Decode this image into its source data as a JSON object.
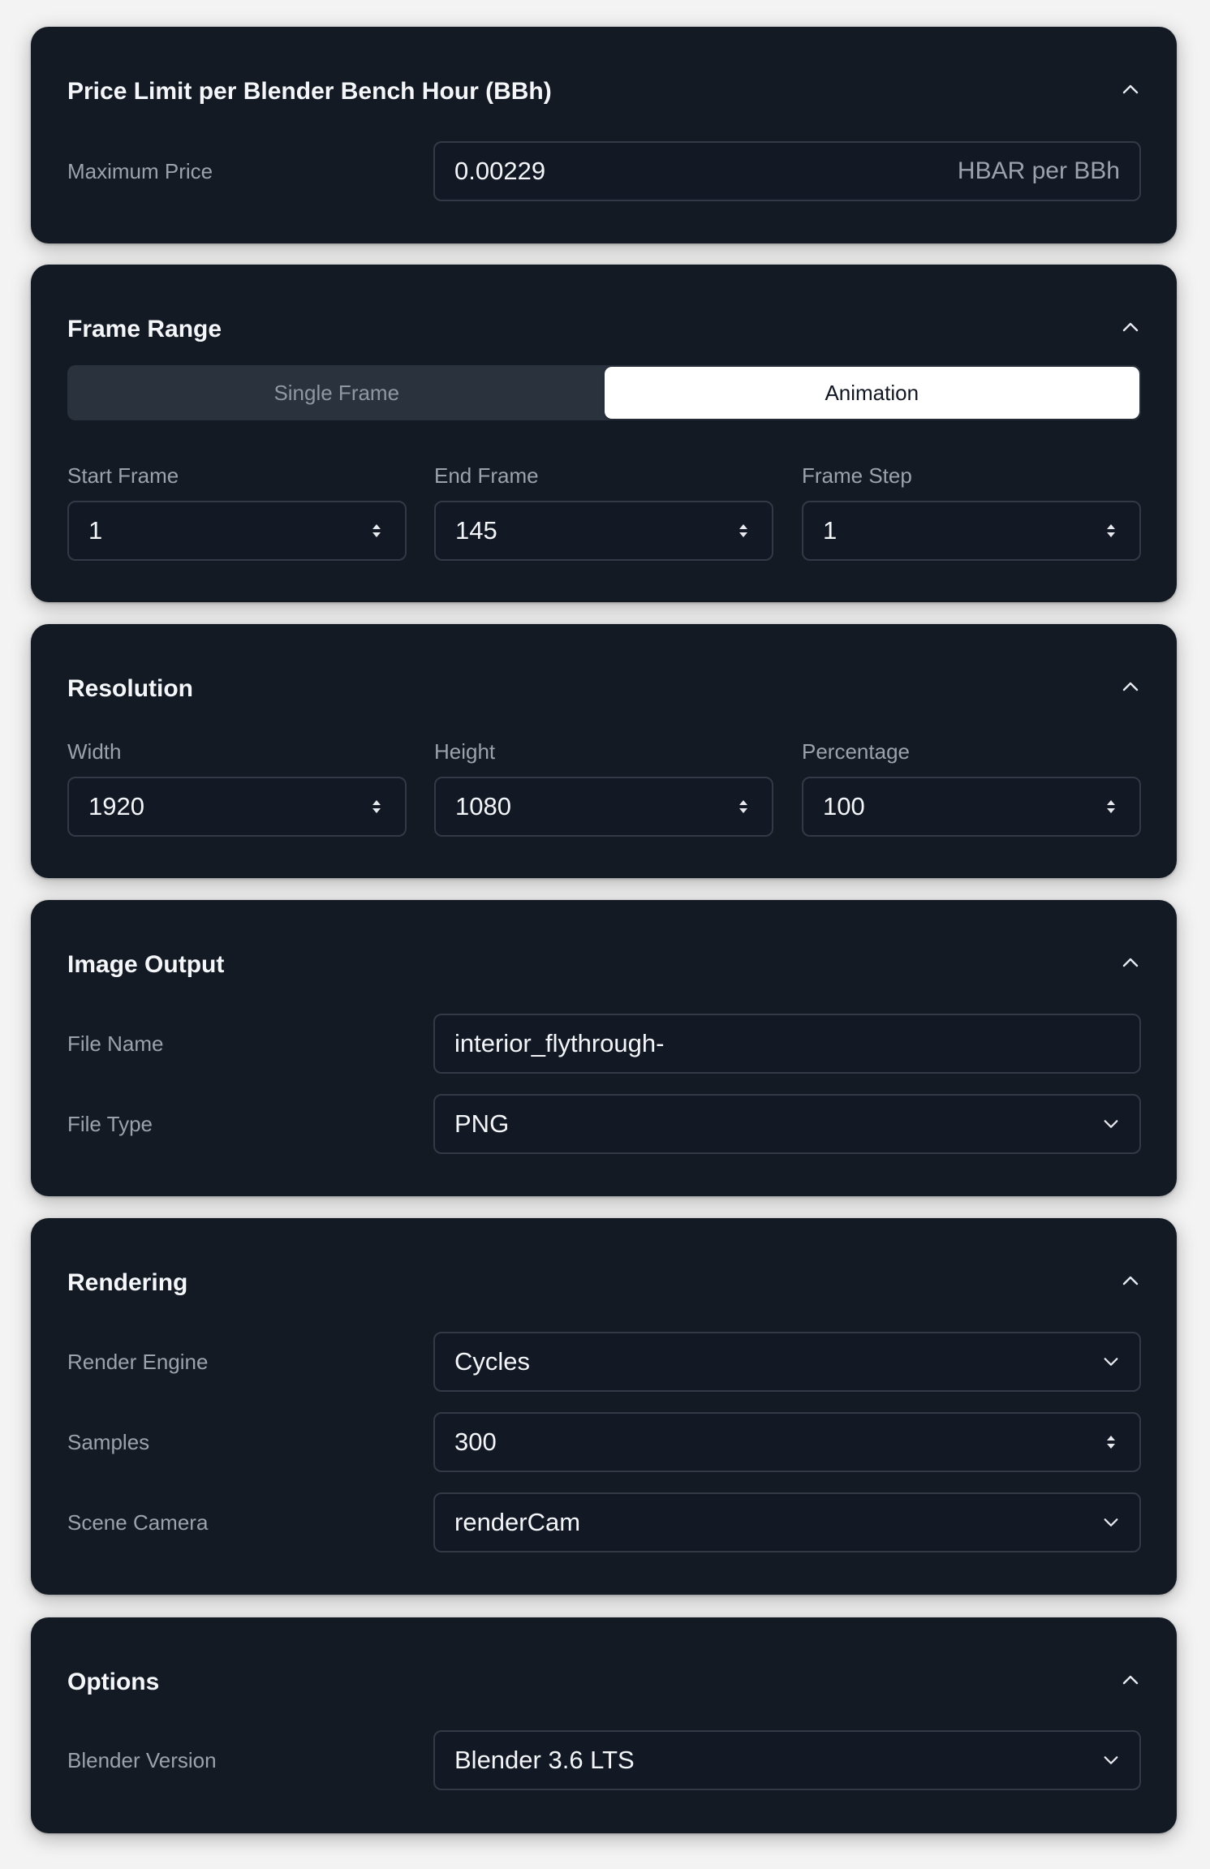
{
  "price": {
    "title": "Price Limit per Blender Bench Hour (BBh)",
    "max_price_label": "Maximum Price",
    "max_price_value": "0.00229",
    "max_price_unit": "HBAR per BBh"
  },
  "frame_range": {
    "title": "Frame Range",
    "modes": [
      "Single Frame",
      "Animation"
    ],
    "active_mode": "Animation",
    "start_label": "Start Frame",
    "start_value": "1",
    "end_label": "End Frame",
    "end_value": "145",
    "step_label": "Frame Step",
    "step_value": "1"
  },
  "resolution": {
    "title": "Resolution",
    "width_label": "Width",
    "width_value": "1920",
    "height_label": "Height",
    "height_value": "1080",
    "percentage_label": "Percentage",
    "percentage_value": "100"
  },
  "image_output": {
    "title": "Image Output",
    "file_name_label": "File Name",
    "file_name_value": "interior_flythrough-",
    "file_type_label": "File Type",
    "file_type_value": "PNG"
  },
  "rendering": {
    "title": "Rendering",
    "engine_label": "Render Engine",
    "engine_value": "Cycles",
    "samples_label": "Samples",
    "samples_value": "300",
    "camera_label": "Scene Camera",
    "camera_value": "renderCam"
  },
  "options": {
    "title": "Options",
    "version_label": "Blender Version",
    "version_value": "Blender 3.6 LTS"
  },
  "icons": {
    "collapse": "chevron-up-icon",
    "stepper": "up-down-arrows-icon",
    "dropdown": "chevron-down-icon"
  },
  "colors": {
    "card_bg": "#131a24",
    "page_bg": "#f3f3f3",
    "field_border": "#313a46",
    "segment_active_bg": "#ffffff"
  }
}
